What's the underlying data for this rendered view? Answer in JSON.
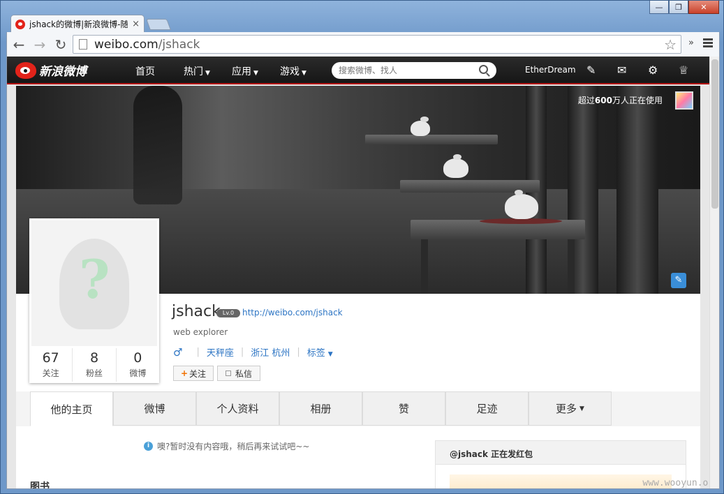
{
  "browser": {
    "tab_title": "jshack的微博|新浪微博-随",
    "url_domain": "weibo.com",
    "url_path": "/jshack",
    "window_controls": [
      "—",
      "❐",
      "✕"
    ]
  },
  "weibo_nav": {
    "logo_text": "新浪微博",
    "links": [
      {
        "label": "首页"
      },
      {
        "label": "热门"
      },
      {
        "label": "应用"
      },
      {
        "label": "游戏"
      }
    ],
    "search_placeholder": "搜索微博、找人",
    "username": "EtherDream",
    "icons": [
      "edit-icon",
      "mail-icon",
      "gear-icon",
      "crown-icon"
    ]
  },
  "cover": {
    "users_prefix": "超过",
    "users_count": "600",
    "users_suffix": "万人正在使用"
  },
  "profile": {
    "name": "jshack",
    "level": "Lv.0",
    "link": "http://weibo.com/jshack",
    "intro": "web explorer",
    "gender": "♂",
    "constellation": "天秤座",
    "location": "浙江 杭州",
    "tags_label": "标签",
    "follow_label": "关注",
    "message_label": "私信",
    "counts": [
      {
        "value": "67",
        "label": "关注"
      },
      {
        "value": "8",
        "label": "粉丝"
      },
      {
        "value": "0",
        "label": "微博"
      }
    ]
  },
  "tabs": [
    {
      "label": "他的主页",
      "active": true
    },
    {
      "label": "微博"
    },
    {
      "label": "个人资料"
    },
    {
      "label": "相册"
    },
    {
      "label": "赞"
    },
    {
      "label": "足迹"
    },
    {
      "label": "更多"
    }
  ],
  "content": {
    "empty_message": "噢?暂时没有内容哦，稍后再来试试吧~~",
    "section_books": "图书",
    "side_title": "@jshack 正在发红包"
  },
  "watermark": "www.wooyun.org"
}
